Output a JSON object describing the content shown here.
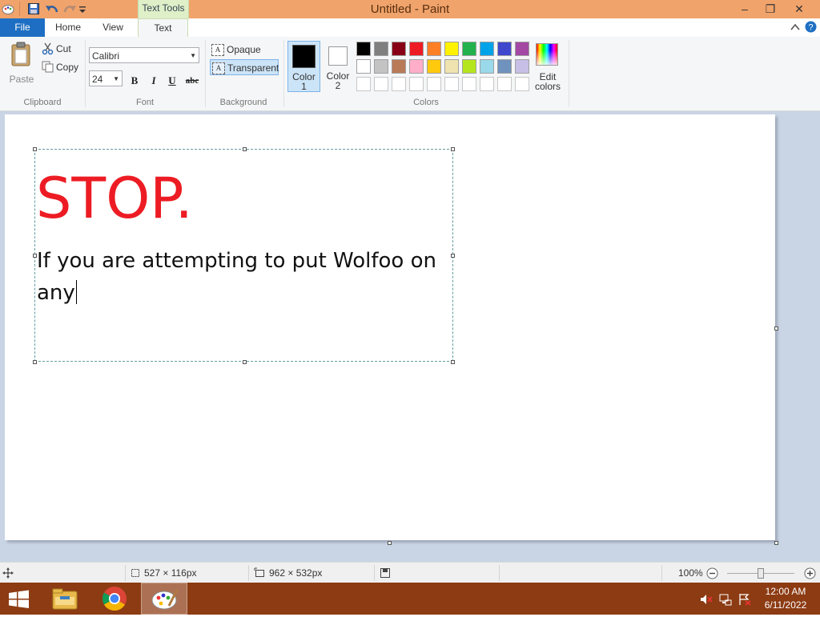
{
  "window": {
    "title": "Untitled - Paint",
    "context_tab": "Text Tools",
    "controls": {
      "minimize": "–",
      "maximize": "❐",
      "close": "✕"
    }
  },
  "tabs": {
    "file": "File",
    "home": "Home",
    "view": "View",
    "text": "Text"
  },
  "clipboard": {
    "paste": "Paste",
    "cut": "Cut",
    "copy": "Copy",
    "group": "Clipboard"
  },
  "font": {
    "family": "Calibri",
    "size": "24",
    "bold": "B",
    "italic": "I",
    "underline": "U",
    "strike": "abc",
    "group": "Font"
  },
  "background": {
    "opaque": "Opaque",
    "transparent": "Transparent",
    "group": "Background"
  },
  "colors": {
    "color1_line1": "Color",
    "color1_line2": "1",
    "color2_line1": "Color",
    "color2_line2": "2",
    "edit_line1": "Edit",
    "edit_line2": "colors",
    "group": "Colors",
    "color1": "#000000",
    "color2": "#ffffff",
    "palette_row1": [
      "#000000",
      "#7f7f7f",
      "#880015",
      "#ed1c24",
      "#ff7f27",
      "#fff200",
      "#22b14c",
      "#00a2e8",
      "#3f48cc",
      "#a349a4"
    ],
    "palette_row2": [
      "#ffffff",
      "#c3c3c3",
      "#b97a57",
      "#ffaec9",
      "#ffc90e",
      "#efe4b0",
      "#b5e61d",
      "#99d9ea",
      "#7092be",
      "#c8bfe7"
    ]
  },
  "canvas": {
    "stop_text": "STOP.",
    "body_text": "If you are attempting to put Wolfoo on any",
    "stop_color": "#ed1c24"
  },
  "status": {
    "selection_size": "527 × 116px",
    "canvas_size": "962 × 532px",
    "zoom": "100%"
  },
  "taskbar": {
    "time": "12:00 AM",
    "date": "6/11/2022"
  }
}
